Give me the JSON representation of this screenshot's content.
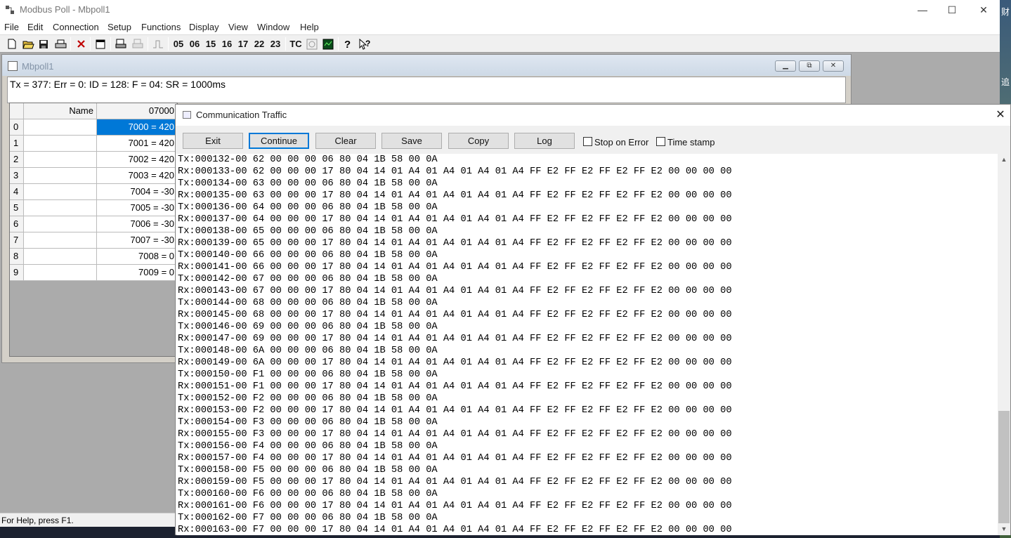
{
  "window": {
    "title": "Modbus Poll - Mbpoll1",
    "minimize": "—",
    "maximize": "☐",
    "close": "✕"
  },
  "menu": [
    "File",
    "Edit",
    "Connection",
    "Setup",
    "Functions",
    "Display",
    "View",
    "Window",
    "Help"
  ],
  "toolbar": {
    "function_codes": [
      "05",
      "06",
      "15",
      "16",
      "17",
      "22",
      "23"
    ],
    "tc_label": "TC"
  },
  "child": {
    "title": "Mbpoll1",
    "status_line": "Tx = 377: Err = 0: ID = 128: F = 04: SR = 1000ms",
    "grid": {
      "col_name": "Name",
      "col_address": "07000",
      "rows": [
        {
          "idx": "0",
          "value": "7000 = 420"
        },
        {
          "idx": "1",
          "value": "7001 = 420"
        },
        {
          "idx": "2",
          "value": "7002 = 420"
        },
        {
          "idx": "3",
          "value": "7003 = 420"
        },
        {
          "idx": "4",
          "value": "7004 = -30"
        },
        {
          "idx": "5",
          "value": "7005 = -30"
        },
        {
          "idx": "6",
          "value": "7006 = -30"
        },
        {
          "idx": "7",
          "value": "7007 = -30"
        },
        {
          "idx": "8",
          "value": "7008 = 0"
        },
        {
          "idx": "9",
          "value": "7009 = 0"
        }
      ]
    }
  },
  "status_bar": {
    "help": "For Help, press F1."
  },
  "desktop": {
    "chars": [
      "财",
      "追"
    ]
  },
  "comm": {
    "title": "Communication Traffic",
    "close": "✕",
    "buttons": {
      "exit": "Exit",
      "continue": "Continue",
      "clear": "Clear",
      "save": "Save",
      "copy": "Copy",
      "log": "Log"
    },
    "stop_on_error": "Stop on Error",
    "time_stamp": "Time stamp",
    "lines": [
      "Tx:000132-00 62 00 00 00 06 80 04 1B 58 00 0A",
      "Rx:000133-00 62 00 00 00 17 80 04 14 01 A4 01 A4 01 A4 01 A4 FF E2 FF E2 FF E2 FF E2 00 00 00 00",
      "Tx:000134-00 63 00 00 00 06 80 04 1B 58 00 0A",
      "Rx:000135-00 63 00 00 00 17 80 04 14 01 A4 01 A4 01 A4 01 A4 FF E2 FF E2 FF E2 FF E2 00 00 00 00",
      "Tx:000136-00 64 00 00 00 06 80 04 1B 58 00 0A",
      "Rx:000137-00 64 00 00 00 17 80 04 14 01 A4 01 A4 01 A4 01 A4 FF E2 FF E2 FF E2 FF E2 00 00 00 00",
      "Tx:000138-00 65 00 00 00 06 80 04 1B 58 00 0A",
      "Rx:000139-00 65 00 00 00 17 80 04 14 01 A4 01 A4 01 A4 01 A4 FF E2 FF E2 FF E2 FF E2 00 00 00 00",
      "Tx:000140-00 66 00 00 00 06 80 04 1B 58 00 0A",
      "Rx:000141-00 66 00 00 00 17 80 04 14 01 A4 01 A4 01 A4 01 A4 FF E2 FF E2 FF E2 FF E2 00 00 00 00",
      "Tx:000142-00 67 00 00 00 06 80 04 1B 58 00 0A",
      "Rx:000143-00 67 00 00 00 17 80 04 14 01 A4 01 A4 01 A4 01 A4 FF E2 FF E2 FF E2 FF E2 00 00 00 00",
      "Tx:000144-00 68 00 00 00 06 80 04 1B 58 00 0A",
      "Rx:000145-00 68 00 00 00 17 80 04 14 01 A4 01 A4 01 A4 01 A4 FF E2 FF E2 FF E2 FF E2 00 00 00 00",
      "Tx:000146-00 69 00 00 00 06 80 04 1B 58 00 0A",
      "Rx:000147-00 69 00 00 00 17 80 04 14 01 A4 01 A4 01 A4 01 A4 FF E2 FF E2 FF E2 FF E2 00 00 00 00",
      "Tx:000148-00 6A 00 00 00 06 80 04 1B 58 00 0A",
      "Rx:000149-00 6A 00 00 00 17 80 04 14 01 A4 01 A4 01 A4 01 A4 FF E2 FF E2 FF E2 FF E2 00 00 00 00",
      "Tx:000150-00 F1 00 00 00 06 80 04 1B 58 00 0A",
      "Rx:000151-00 F1 00 00 00 17 80 04 14 01 A4 01 A4 01 A4 01 A4 FF E2 FF E2 FF E2 FF E2 00 00 00 00",
      "Tx:000152-00 F2 00 00 00 06 80 04 1B 58 00 0A",
      "Rx:000153-00 F2 00 00 00 17 80 04 14 01 A4 01 A4 01 A4 01 A4 FF E2 FF E2 FF E2 FF E2 00 00 00 00",
      "Tx:000154-00 F3 00 00 00 06 80 04 1B 58 00 0A",
      "Rx:000155-00 F3 00 00 00 17 80 04 14 01 A4 01 A4 01 A4 01 A4 FF E2 FF E2 FF E2 FF E2 00 00 00 00",
      "Tx:000156-00 F4 00 00 00 06 80 04 1B 58 00 0A",
      "Rx:000157-00 F4 00 00 00 17 80 04 14 01 A4 01 A4 01 A4 01 A4 FF E2 FF E2 FF E2 FF E2 00 00 00 00",
      "Tx:000158-00 F5 00 00 00 06 80 04 1B 58 00 0A",
      "Rx:000159-00 F5 00 00 00 17 80 04 14 01 A4 01 A4 01 A4 01 A4 FF E2 FF E2 FF E2 FF E2 00 00 00 00",
      "Tx:000160-00 F6 00 00 00 06 80 04 1B 58 00 0A",
      "Rx:000161-00 F6 00 00 00 17 80 04 14 01 A4 01 A4 01 A4 01 A4 FF E2 FF E2 FF E2 FF E2 00 00 00 00",
      "Tx:000162-00 F7 00 00 00 06 80 04 1B 58 00 0A",
      "Rx:000163-00 F7 00 00 00 17 80 04 14 01 A4 01 A4 01 A4 01 A4 FF E2 FF E2 FF E2 FF E2 00 00 00 00"
    ]
  },
  "icons": {
    "toolbar": [
      "new-file-icon",
      "open-folder-icon",
      "save-icon",
      "print-icon",
      "delete-icon",
      "window-icon",
      "read-write-icon",
      "print-disabled-icon",
      "pulse-icon",
      "tc-icon",
      "traffic-disabled-icon",
      "monitor-icon",
      "help-icon",
      "context-help-icon"
    ]
  },
  "colors": {
    "selection": "#0078d7",
    "focus_border": "#0078d7"
  }
}
